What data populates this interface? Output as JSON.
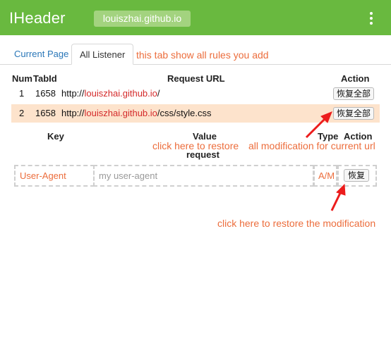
{
  "header": {
    "title": "IHeader",
    "domain": "louiszhai.github.io"
  },
  "tabs": [
    {
      "label": "Current Page"
    },
    {
      "label": "All Listener"
    }
  ],
  "annotations": {
    "tabs_note": "this tab show all rules you add",
    "restore_all_left": "click here to restore",
    "restore_all_right": "all modification for current url",
    "restore_one": "click here to restore the modification"
  },
  "rules_table": {
    "headers": {
      "num": "Num",
      "tabid": "TabId",
      "url": "Request URL",
      "action": "Action"
    },
    "rows": [
      {
        "num": "1",
        "tabid": "1658",
        "url_prefix": "http://",
        "url_domain": "louiszhai.github.io",
        "url_path": "/",
        "action": "恢复全部"
      },
      {
        "num": "2",
        "tabid": "1658",
        "url_prefix": "http://",
        "url_domain": "louiszhai.github.io",
        "url_path": "/css/style.css",
        "action": "恢复全部"
      }
    ]
  },
  "modification_table": {
    "headers": {
      "key": "Key",
      "value": "Value",
      "value_sub": "request",
      "type": "Type",
      "action": "Action"
    },
    "rows": [
      {
        "key": "User-Agent",
        "value": "my user-agent",
        "type": "A/M",
        "action": "恢复"
      }
    ]
  },
  "colors": {
    "header": "#69b93f",
    "annotation": "#ec6d3c",
    "url_domain": "#d42a2a",
    "row_highlight": "#fde3cc"
  }
}
